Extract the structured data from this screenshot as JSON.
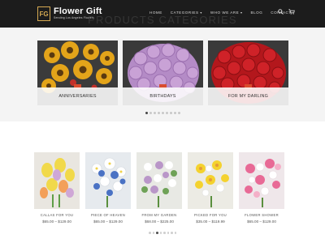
{
  "brand": {
    "name": "Flower Gift",
    "tagline": "Sending Los Angeles Flowers",
    "mark": "FG"
  },
  "nav": [
    {
      "label": "HOME"
    },
    {
      "label": "CATEGORIES"
    },
    {
      "label": "WHO WE ARE"
    },
    {
      "label": "BLOG"
    },
    {
      "label": "CONTACT"
    }
  ],
  "section_title": "PRODUCTS CATEGORIES",
  "categories": [
    {
      "label": "ANNIVERSARIES"
    },
    {
      "label": "BIRTHDAYS"
    },
    {
      "label": "FOR MY DARLING"
    }
  ],
  "category_pages": 9,
  "products": [
    {
      "name": "CALLAS FOR YOU",
      "price": "$65.00 – $129.00"
    },
    {
      "name": "PIECE OF HEAVEN",
      "price": "$65.00 – $129.00"
    },
    {
      "name": "FROM MY GARDEN",
      "price": "$68.00 – $225.00"
    },
    {
      "name": "PICKED FOR YOU",
      "price": "$35.00 – $119.99"
    },
    {
      "name": "FLOWER SHOWER",
      "price": "$65.00 – $129.00"
    }
  ],
  "colors": {
    "header": "#1c1c1c",
    "accent": "#d6aa52",
    "badge": "#d94c2f"
  }
}
